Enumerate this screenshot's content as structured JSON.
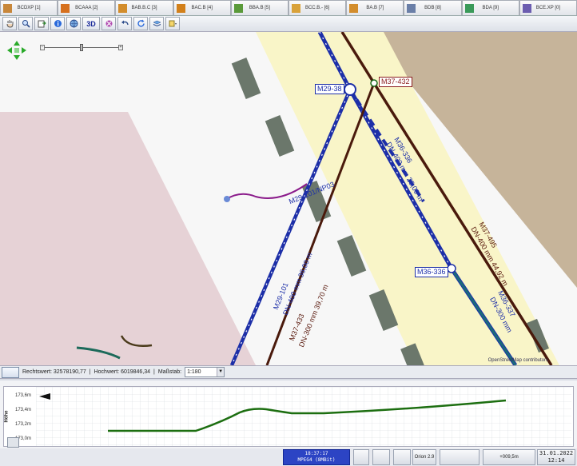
{
  "tabs": [
    {
      "label": "BCDXP [1]",
      "icon": "document-icon",
      "color": "#c8873a"
    },
    {
      "label": "BCAAA [2]",
      "icon": "pen-icon",
      "color": "#d6701e"
    },
    {
      "label": "BAB.B.C [3]",
      "icon": "tag-icon",
      "color": "#d38d2c"
    },
    {
      "label": "BAC.B [4]",
      "icon": "layers-icon",
      "color": "#d2801b"
    },
    {
      "label": "BBA.B [5]",
      "icon": "puzzle-icon",
      "color": "#5a9a3a"
    },
    {
      "label": "BCC.B.- [6]",
      "icon": "pencil-icon",
      "color": "#d9a23a"
    },
    {
      "label": "BA.B [7]",
      "icon": "tag-icon",
      "color": "#d38d2c"
    },
    {
      "label": "BDB [8]",
      "icon": "edit-icon",
      "color": "#6a7fa8"
    },
    {
      "label": "BDA [9]",
      "icon": "image-icon",
      "color": "#3a9a5a"
    },
    {
      "label": "BCE.XP [0]",
      "icon": "book-icon",
      "color": "#6b5db0"
    }
  ],
  "toolbar": {
    "buttons": [
      "hand-icon",
      "magnifier-icon",
      "export-icon",
      "info-icon",
      "globe-icon",
      "3D",
      "tools-icon",
      "undo-icon",
      "refresh-icon",
      "layers-icon",
      "dropdown-icon"
    ]
  },
  "map": {
    "labels": {
      "node1": "M29-38",
      "node2": "M37-432",
      "node3": "M36-336",
      "pipe1": "M29-101/NP03",
      "pipe_a1": "M29-101",
      "pipe_a2": "DN-400 mm 36,00 m",
      "pipe_b1": "M37-433",
      "pipe_b2": "DN-300 mm 39,70 m",
      "pipe_c1": "M36-336",
      "pipe_c2": "DN-400 mm 25,09 m",
      "pipe_d1": "M37-495",
      "pipe_d2": "DN-400 mm 44,92 m",
      "pipe_e1": "M36-337",
      "pipe_e2": "DN-300 mm"
    },
    "attribution": "OpenStreetMap contributors"
  },
  "status": {
    "rechtswert": "Rechtswert: 32578190,77",
    "hochwert": "Hochwert: 6019846,34",
    "massstab_label": "Maßstab:",
    "scale": "1:180"
  },
  "profile": {
    "axis_title": "Höhe",
    "y_ticks": [
      "173,6m",
      "173,4m",
      "173,2m",
      "173,0m"
    ],
    "line_color": "#1c6e10"
  },
  "taskbar": {
    "clock_time": "18:37:17",
    "clock_sub": "MPEG4 (8MBit)",
    "orion": "Orion 2.9",
    "height_value": "+009,5m",
    "date": "31.01.2022",
    "time": "12:14"
  }
}
